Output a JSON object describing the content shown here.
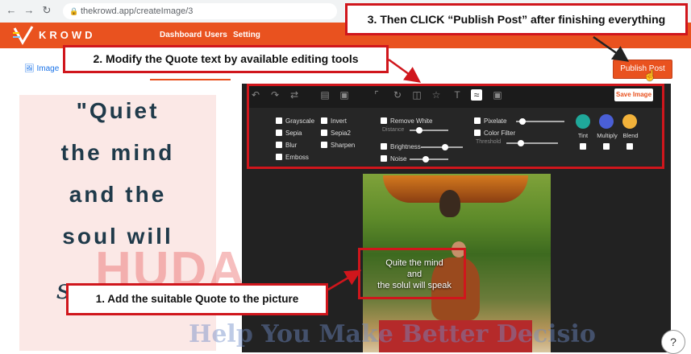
{
  "browser": {
    "url": "thekrowd.app/createImage/3"
  },
  "header": {
    "logo": "KROWD",
    "nav": [
      "Dashboard",
      "Users",
      "Setting"
    ]
  },
  "toolbar": {
    "image_tab": "Image",
    "publish_label": "Publish Post",
    "save_image": "Save Image"
  },
  "quote_card": {
    "lines": [
      "\"Quiet",
      "the mind",
      "and the",
      "soul will"
    ],
    "script": "sp..."
  },
  "filters": {
    "col1": [
      "Grayscale",
      "Sepia",
      "Blur",
      "Emboss"
    ],
    "col2": [
      "Invert",
      "Sepia2",
      "Sharpen"
    ],
    "remove_white": "Remove White",
    "distance": "Distance",
    "brightness": "Brightness",
    "noise": "Noise",
    "pixelate": "Pixelate",
    "color_filter": "Color Filter",
    "threshold": "Threshold",
    "swatches": [
      {
        "label": "Tint",
        "color": "#1fa89a"
      },
      {
        "label": "Multiply",
        "color": "#4a5fd6"
      },
      {
        "label": "Blend",
        "color": "#f2b23a"
      }
    ]
  },
  "photo": {
    "quote_line1": "Quite the mind",
    "quote_line2": "and",
    "quote_line3": "the solul will speak"
  },
  "annotations": {
    "step1": "1. Add the suitable Quote to the picture",
    "step2": "2. Modify the Quote text by available editing tools",
    "step3": "3. Then CLICK “Publish Post” after finishing everything"
  },
  "watermark": {
    "big": "HUDA",
    "small": "Help You Make Better Decisio"
  },
  "colors": {
    "accent": "#e9521f",
    "annotation": "#d0161c"
  }
}
